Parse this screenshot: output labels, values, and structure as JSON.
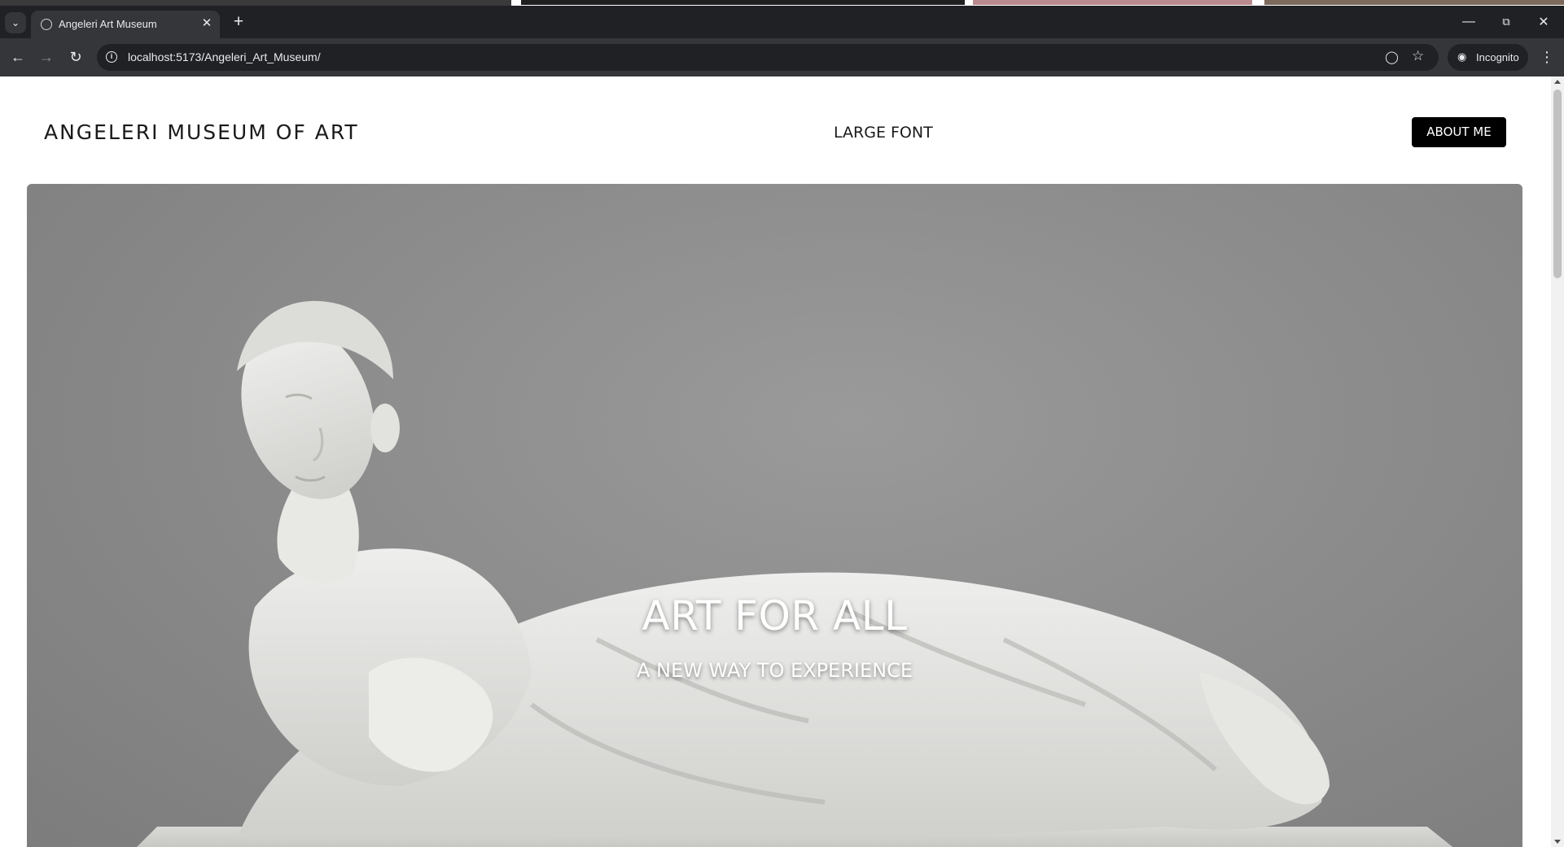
{
  "browser": {
    "tab_title": "Angeleri Art Museum",
    "url": "localhost:5173/Angeleri_Art_Museum/",
    "incognito_label": "Incognito"
  },
  "header": {
    "brand": "ANGELERI MUSEUM OF ART",
    "large_font_label": "LARGE FONT",
    "about_label": "ABOUT ME"
  },
  "hero": {
    "title": "ART FOR ALL",
    "subtitle": "A NEW WAY TO EXPERIENCE",
    "image_alt": "marble sculpture of a reclining figure"
  },
  "icons": [
    "tab-list-icon",
    "favicon-icon",
    "close-tab-icon",
    "new-tab-icon",
    "minimize-icon",
    "restore-icon",
    "close-window-icon",
    "back-icon",
    "forward-icon",
    "reload-icon",
    "site-info-icon",
    "eye-off-icon",
    "bookmark-star-icon",
    "incognito-icon",
    "kebab-menu-icon"
  ],
  "colors": {
    "hero_bg": "#8c8c8c",
    "about_bg": "#000000",
    "chrome_dark": "#202124",
    "chrome_mid": "#35363a"
  }
}
